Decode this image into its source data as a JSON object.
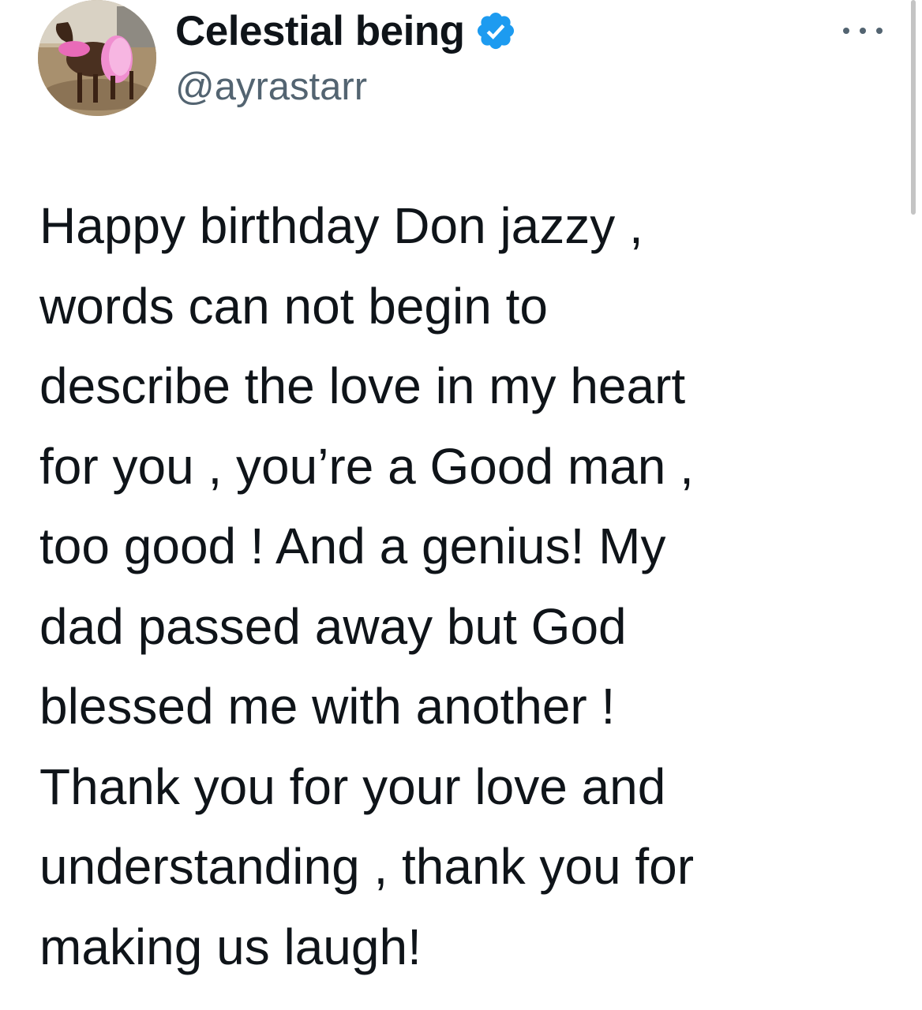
{
  "author": {
    "display_name": "Celestial being",
    "handle": "@ayrastarr",
    "verified": true,
    "verified_color": "#1d9bf0",
    "avatar_icon": "avatar-photo-goat-in-pink-tutu"
  },
  "menu": {
    "icon": "more-horizontal-icon"
  },
  "tweet": {
    "lines": [
      "Happy birthday Don jazzy ,",
      "words can not begin to",
      "describe the love in my heart",
      "for you , you’re a Good man ,",
      "too good ! And a genius! My",
      "dad passed away but God",
      "blessed me with another !",
      "Thank you for your love and",
      "understanding , thank you for",
      "making us laugh!"
    ]
  },
  "colors": {
    "text_primary": "#0f1419",
    "text_secondary": "#536471",
    "background": "#ffffff"
  }
}
